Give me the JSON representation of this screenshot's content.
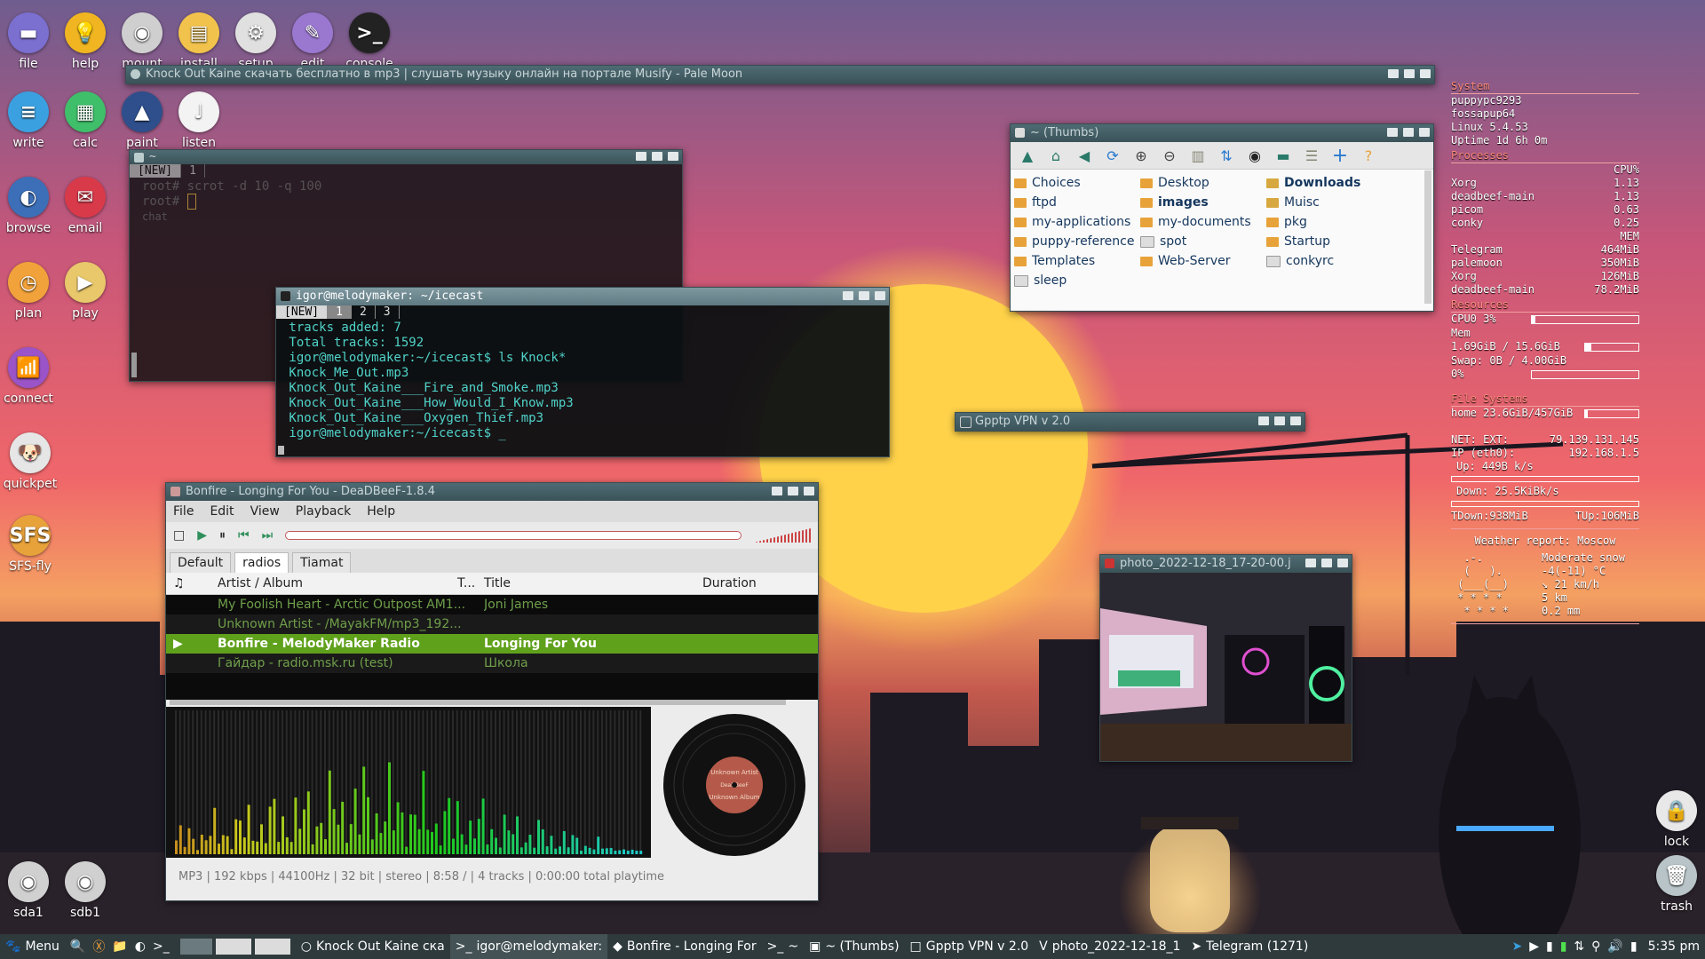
{
  "desktop_icons": [
    {
      "label": "file",
      "glyph": "▬",
      "color": "#7b6fd0"
    },
    {
      "label": "help",
      "glyph": "💡",
      "color": "#f0b521"
    },
    {
      "label": "mount",
      "glyph": "◉",
      "color": "#cfcfcf"
    },
    {
      "label": "install",
      "glyph": "▤",
      "color": "#f2c34c"
    },
    {
      "label": "setup",
      "glyph": "⚙",
      "color": "#e0e0e0"
    },
    {
      "label": "edit",
      "glyph": "✎",
      "color": "#9a78d0"
    },
    {
      "label": "console",
      "glyph": ">_",
      "color": "#222222"
    },
    {
      "label": "write",
      "glyph": "≡",
      "color": "#3ba0e0"
    },
    {
      "label": "calc",
      "glyph": "▦",
      "color": "#3fbf6a"
    },
    {
      "label": "paint",
      "glyph": "▲",
      "color": "#2e4f8c"
    },
    {
      "label": "listen",
      "glyph": "♩",
      "color": "#f3f3f3"
    },
    {
      "label": "browse",
      "glyph": "◐",
      "color": "#3d6fb8"
    },
    {
      "label": "email",
      "glyph": "✉",
      "color": "#d93a4a"
    },
    {
      "label": "plan",
      "glyph": "◷",
      "color": "#f2a23a"
    },
    {
      "label": "play",
      "glyph": "▶",
      "color": "#e8c86a"
    },
    {
      "label": "connect",
      "glyph": "📶",
      "color": "#9a54c8"
    },
    {
      "label": "quickpet",
      "glyph": "🐶",
      "color": "#e6e6e6"
    },
    {
      "label": "SFS-fly",
      "glyph": "SFS",
      "color": "#e8a23a"
    },
    {
      "label": "sda1",
      "glyph": "◉",
      "color": "#d0d0d0"
    },
    {
      "label": "sdb1",
      "glyph": "◉",
      "color": "#d0d0d0"
    },
    {
      "label": "lock",
      "glyph": "🔒",
      "color": "#e8e8e8"
    },
    {
      "label": "trash",
      "glyph": "🗑",
      "color": "#b8c4c8"
    }
  ],
  "palemoon": {
    "title": "Knock Out Kaine скачать бесплатно в mp3 | слушать музыку онлайн на портале Musify - Pale Moon"
  },
  "term1": {
    "title": "~",
    "tabs": [
      "[NEW]",
      "1"
    ],
    "lines": [
      "root# scrot -d 10 -q 100",
      "root# "
    ],
    "chat_label": "chat"
  },
  "term2": {
    "title": "igor@melodymaker: ~/icecast",
    "tabs": [
      "[NEW]",
      "1",
      "2",
      "3"
    ],
    "lines": [
      " tracks added: 7",
      " Total tracks: 1592",
      " igor@melodymaker:~/icecast$ ls Knock*",
      " Knock_Me_Out.mp3",
      " Knock_Out_Kaine___Fire_and_Smoke.mp3",
      " Knock_Out_Kaine___How_Would_I_Know.mp3",
      " Knock_Out_Kaine___Oxygen_Thief.mp3",
      " igor@melodymaker:~/icecast$ _"
    ]
  },
  "rox": {
    "title": "~ (Thumbs)",
    "items": [
      {
        "name": "Choices",
        "type": "folder",
        "bold": false
      },
      {
        "name": "Desktop",
        "type": "folder",
        "bold": false
      },
      {
        "name": "Downloads",
        "type": "app",
        "bold": true
      },
      {
        "name": "ftpd",
        "type": "folder",
        "bold": false
      },
      {
        "name": "images",
        "type": "folder",
        "bold": true
      },
      {
        "name": "Muisc",
        "type": "app",
        "bold": false
      },
      {
        "name": "my-applications",
        "type": "folder",
        "bold": false
      },
      {
        "name": "my-documents",
        "type": "folder",
        "bold": false
      },
      {
        "name": "pkg",
        "type": "folder",
        "bold": false
      },
      {
        "name": "puppy-reference",
        "type": "folder",
        "bold": false
      },
      {
        "name": "spot",
        "type": "file",
        "bold": false
      },
      {
        "name": "Startup",
        "type": "folder",
        "bold": false
      },
      {
        "name": "Templates",
        "type": "folder",
        "bold": false
      },
      {
        "name": "Web-Server",
        "type": "folder",
        "bold": false
      },
      {
        "name": "conkyrc",
        "type": "file",
        "bold": false
      },
      {
        "name": "sleep",
        "type": "file",
        "bold": false
      }
    ]
  },
  "vpn": {
    "title": "Gpptp VPN v 2.0"
  },
  "photo": {
    "title": "photo_2022-12-18_17-20-00.j"
  },
  "deadbeef": {
    "title": "Bonfire - Longing For You - DeaDBeeF-1.8.4",
    "menu": [
      "File",
      "Edit",
      "View",
      "Playback",
      "Help"
    ],
    "tabs": [
      "Default",
      "radios",
      "Tiamat"
    ],
    "headers": {
      "icon": "♫",
      "artist": "Artist / Album",
      "t": "T...",
      "title": "Title",
      "duration": "Duration"
    },
    "rows": [
      {
        "artist": "My Foolish Heart - Arctic Outpost AM1...",
        "title": "Joni James",
        "playing": false
      },
      {
        "artist": "Unknown Artist - /MayakFM/mp3_192...",
        "title": "",
        "playing": false
      },
      {
        "artist": "Bonfire - MelodyMaker Radio",
        "title": "Longing For You",
        "playing": true
      },
      {
        "artist": "Гайдар - radio.msk.ru (test)",
        "title": "Школа",
        "playing": false
      }
    ],
    "status": "MP3 | 192 kbps | 44100Hz | 32 bit | stereo | 8:58 / | 4 tracks | 0:00:00 total playtime",
    "vinyl_top": "Unknown Artist",
    "vinyl_mid": "DeaDBeeF",
    "vinyl_bottom": "Unknown Album"
  },
  "conky": {
    "system_h": "System",
    "host": "puppypc9293",
    "distro": "fossapup64",
    "kernel": "Linux 5.4.53",
    "uptime": "Uptime 1d 6h 0m",
    "processes_h": "Processes",
    "cpu_h": "CPU%",
    "cpu_procs": [
      [
        "Xorg",
        "1.13"
      ],
      [
        "deadbeef-main",
        "1.13"
      ],
      [
        "picom",
        "0.63"
      ],
      [
        "conky",
        "0.25"
      ]
    ],
    "mem_h": "MEM",
    "mem_procs": [
      [
        "Telegram",
        "464MiB"
      ],
      [
        "palemoon",
        "350MiB"
      ],
      [
        "Xorg",
        "126MiB"
      ],
      [
        "deadbeef-main",
        "78.2MiB"
      ]
    ],
    "resources_h": "Resources",
    "cpu0": "CPU0 3%",
    "cpu0_fill": 0.03,
    "mem_label": "Mem",
    "mem_val": "1.69GiB / 15.6GiB",
    "mem_fill": 0.11,
    "swap": "Swap: 0B   / 4.00GiB",
    "swap_pct": "0%",
    "swap_fill": 0,
    "fs_h": "File Systems",
    "home": "home 23.6GiB/457GiB",
    "home_fill": 0.05,
    "net_ext_label": "NET: EXT:",
    "net_ext": "79.139.131.145",
    "ip_label": "IP (eth0):",
    "ip": "192.168.1.5",
    "up": "Up: 449B   k/s",
    "down": "Down: 25.5KiBk/s",
    "tdown": "TDown:938MiB",
    "tup": "TUp:106MiB",
    "weather_h": "Weather report: Moscow",
    "weather_art": [
      "  .-.  ",
      "  (   ). ",
      " (___(__)",
      " * * * * ",
      "  * * * *"
    ],
    "weather_vals": [
      "Moderate snow",
      "-4(-11) °C",
      "↘ 21 km/h",
      "5 km",
      "0.2 mm"
    ]
  },
  "taskbar": {
    "menu": "Menu",
    "items": [
      {
        "label": "Knock Out Kaine ска",
        "active": false
      },
      {
        "label": "igor@melodymaker:",
        "active": true
      },
      {
        "label": "Bonfire - Longing For",
        "active": false
      },
      {
        "label": "~",
        "active": false
      },
      {
        "label": "~ (Thumbs)",
        "active": false
      },
      {
        "label": "Gpptp VPN v 2.0",
        "active": false
      },
      {
        "label": "photo_2022-12-18_1",
        "active": false
      },
      {
        "label": "Telegram (1271)",
        "active": false
      }
    ],
    "clock": "5:35 pm"
  },
  "colors": {
    "accent": "#5fa11b",
    "title_active": "#6f8a92",
    "title_inactive": "#45606a",
    "conky_head": "#ff8a7a"
  }
}
